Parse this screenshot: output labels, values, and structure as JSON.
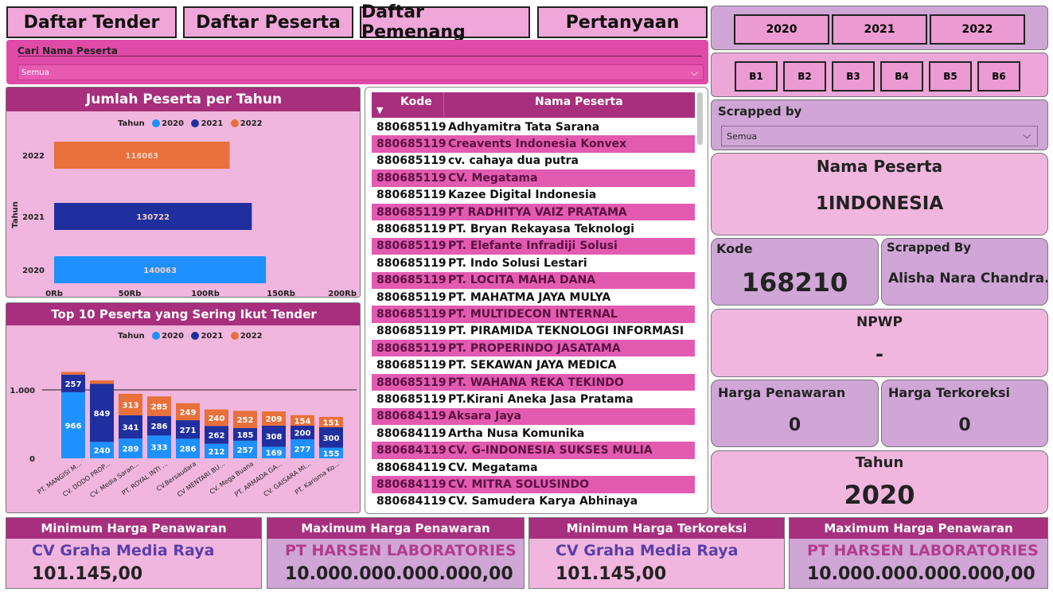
{
  "nav": {
    "tabs": [
      {
        "label": "Daftar Tender"
      },
      {
        "label": "Daftar Peserta"
      },
      {
        "label": "Daftar Pemenang"
      },
      {
        "label": "Pertanyaan"
      }
    ]
  },
  "filters": {
    "years": [
      "2020",
      "2021",
      "2022"
    ],
    "batches": [
      "B1",
      "B2",
      "B3",
      "B4",
      "B5",
      "B6"
    ],
    "search_label": "Cari Nama Peserta",
    "search_value": "Semua",
    "scrapped_label": "Scrapped by",
    "scrapped_value": "Semua"
  },
  "colors": {
    "y2020": "#1e90ff",
    "y2021": "#1f2f9e",
    "y2022": "#e8703a",
    "header": "#a72f7d",
    "row_alt": "#e35bb0",
    "panel": "#f0b6de"
  },
  "chart_data": [
    {
      "type": "bar",
      "orientation": "horizontal",
      "title": "Jumlah Peserta per Tahun",
      "legend_title": "Tahun",
      "legend": [
        "2020",
        "2021",
        "2022"
      ],
      "ylabel": "Tahun",
      "categories": [
        "2022",
        "2021",
        "2020"
      ],
      "values": [
        116063,
        130722,
        140063
      ],
      "value_labels": [
        "116063",
        "130722",
        "140063"
      ],
      "xticks": [
        "0Rb",
        "50Rb",
        "100Rb",
        "150Rb",
        "200Rb"
      ],
      "xlim": [
        0,
        200000
      ]
    },
    {
      "type": "bar",
      "stacked": true,
      "title": "Top 10 Peserta yang Sering Ikut Tender",
      "legend_title": "Tahun",
      "legend": [
        "2020",
        "2021",
        "2022"
      ],
      "categories": [
        "PT. MANGISI M...",
        "CV. DODO PROP...",
        "CV. Media Saran...",
        "PT. ROYAL INTI ...",
        "CV.Bersaudara",
        "CV MENTARI BU...",
        "CV. Mega Buana",
        "PT. ARMADA GA...",
        "CV. GAISARA MI...",
        "PT. Karisma Ko..."
      ],
      "series": [
        {
          "name": "2020",
          "values": [
            966,
            240,
            289,
            333,
            286,
            212,
            257,
            169,
            277,
            155
          ]
        },
        {
          "name": "2021",
          "values": [
            257,
            849,
            341,
            286,
            271,
            262,
            185,
            308,
            200,
            300
          ]
        },
        {
          "name": "2022",
          "values": [
            40,
            50,
            313,
            285,
            249,
            240,
            252,
            209,
            154,
            151
          ]
        }
      ],
      "yticks": [
        "0",
        "1.000"
      ],
      "ylim": [
        0,
        1500
      ]
    }
  ],
  "table": {
    "headers": {
      "kode": "Kode",
      "nama": "Nama Peserta"
    },
    "rows": [
      {
        "kode": "880685119",
        "nama": "Adhyamitra Tata Sarana"
      },
      {
        "kode": "880685119",
        "nama": "Creavents Indonesia Konvex"
      },
      {
        "kode": "880685119",
        "nama": "cv. cahaya dua putra"
      },
      {
        "kode": "880685119",
        "nama": "CV. Megatama"
      },
      {
        "kode": "880685119",
        "nama": "Kazee Digital Indonesia"
      },
      {
        "kode": "880685119",
        "nama": "PT RADHITYA VAIZ PRATAMA"
      },
      {
        "kode": "880685119",
        "nama": "PT. Bryan Rekayasa Teknologi"
      },
      {
        "kode": "880685119",
        "nama": "PT. Elefante Infradiji Solusi"
      },
      {
        "kode": "880685119",
        "nama": "PT. Indo Solusi Lestari"
      },
      {
        "kode": "880685119",
        "nama": "PT. LOCITA MAHA DANA"
      },
      {
        "kode": "880685119",
        "nama": "PT. MAHATMA JAYA MULYA"
      },
      {
        "kode": "880685119",
        "nama": "PT. MULTIDECON INTERNAL"
      },
      {
        "kode": "880685119",
        "nama": "PT. PIRAMIDA TEKNOLOGI INFORMASI"
      },
      {
        "kode": "880685119",
        "nama": "PT. PROPERINDO JASATAMA"
      },
      {
        "kode": "880685119",
        "nama": "PT. SEKAWAN JAYA MEDICA"
      },
      {
        "kode": "880685119",
        "nama": "PT. WAHANA REKA TEKINDO"
      },
      {
        "kode": "880685119",
        "nama": "PT.Kirani Aneka Jasa Pratama"
      },
      {
        "kode": "880684119",
        "nama": "Aksara Jaya"
      },
      {
        "kode": "880684119",
        "nama": "Artha Nusa Komunika"
      },
      {
        "kode": "880684119",
        "nama": "CV. G-INDONESIA SUKSES MULIA"
      },
      {
        "kode": "880684119",
        "nama": "CV. Megatama"
      },
      {
        "kode": "880684119",
        "nama": "CV. MITRA SOLUSINDO"
      },
      {
        "kode": "880684119",
        "nama": "CV. Samudera Karya Abhinaya"
      }
    ]
  },
  "cards": {
    "nama_peserta": {
      "title": "Nama Peserta",
      "value": "1INDONESIA"
    },
    "kode": {
      "title": "Kode",
      "value": "168210"
    },
    "scrapped_by": {
      "title": "Scrapped By",
      "value": "Alisha Nara Chandra..."
    },
    "npwp": {
      "title": "NPWP",
      "value": "-"
    },
    "harga_penawaran": {
      "title": "Harga Penawaran",
      "value": "0"
    },
    "harga_terkoreksi": {
      "title": "Harga Terkoreksi",
      "value": "0"
    },
    "tahun": {
      "title": "Tahun",
      "value": "2020"
    }
  },
  "bottom": [
    {
      "title": "Minimum Harga Penawaran",
      "name": "CV Graha Media Raya",
      "value": "101.145,00"
    },
    {
      "title": "Maximum Harga Penawaran",
      "name": "PT HARSEN LABORATORIES",
      "value": "10.000.000.000.000,00"
    },
    {
      "title": "Minimum Harga Terkoreksi",
      "name": "CV Graha Media Raya",
      "value": "101.145,00"
    },
    {
      "title": "Maximum Harga Penawaran",
      "name": "PT HARSEN LABORATORIES",
      "value": "10.000.000.000.000,00"
    }
  ]
}
